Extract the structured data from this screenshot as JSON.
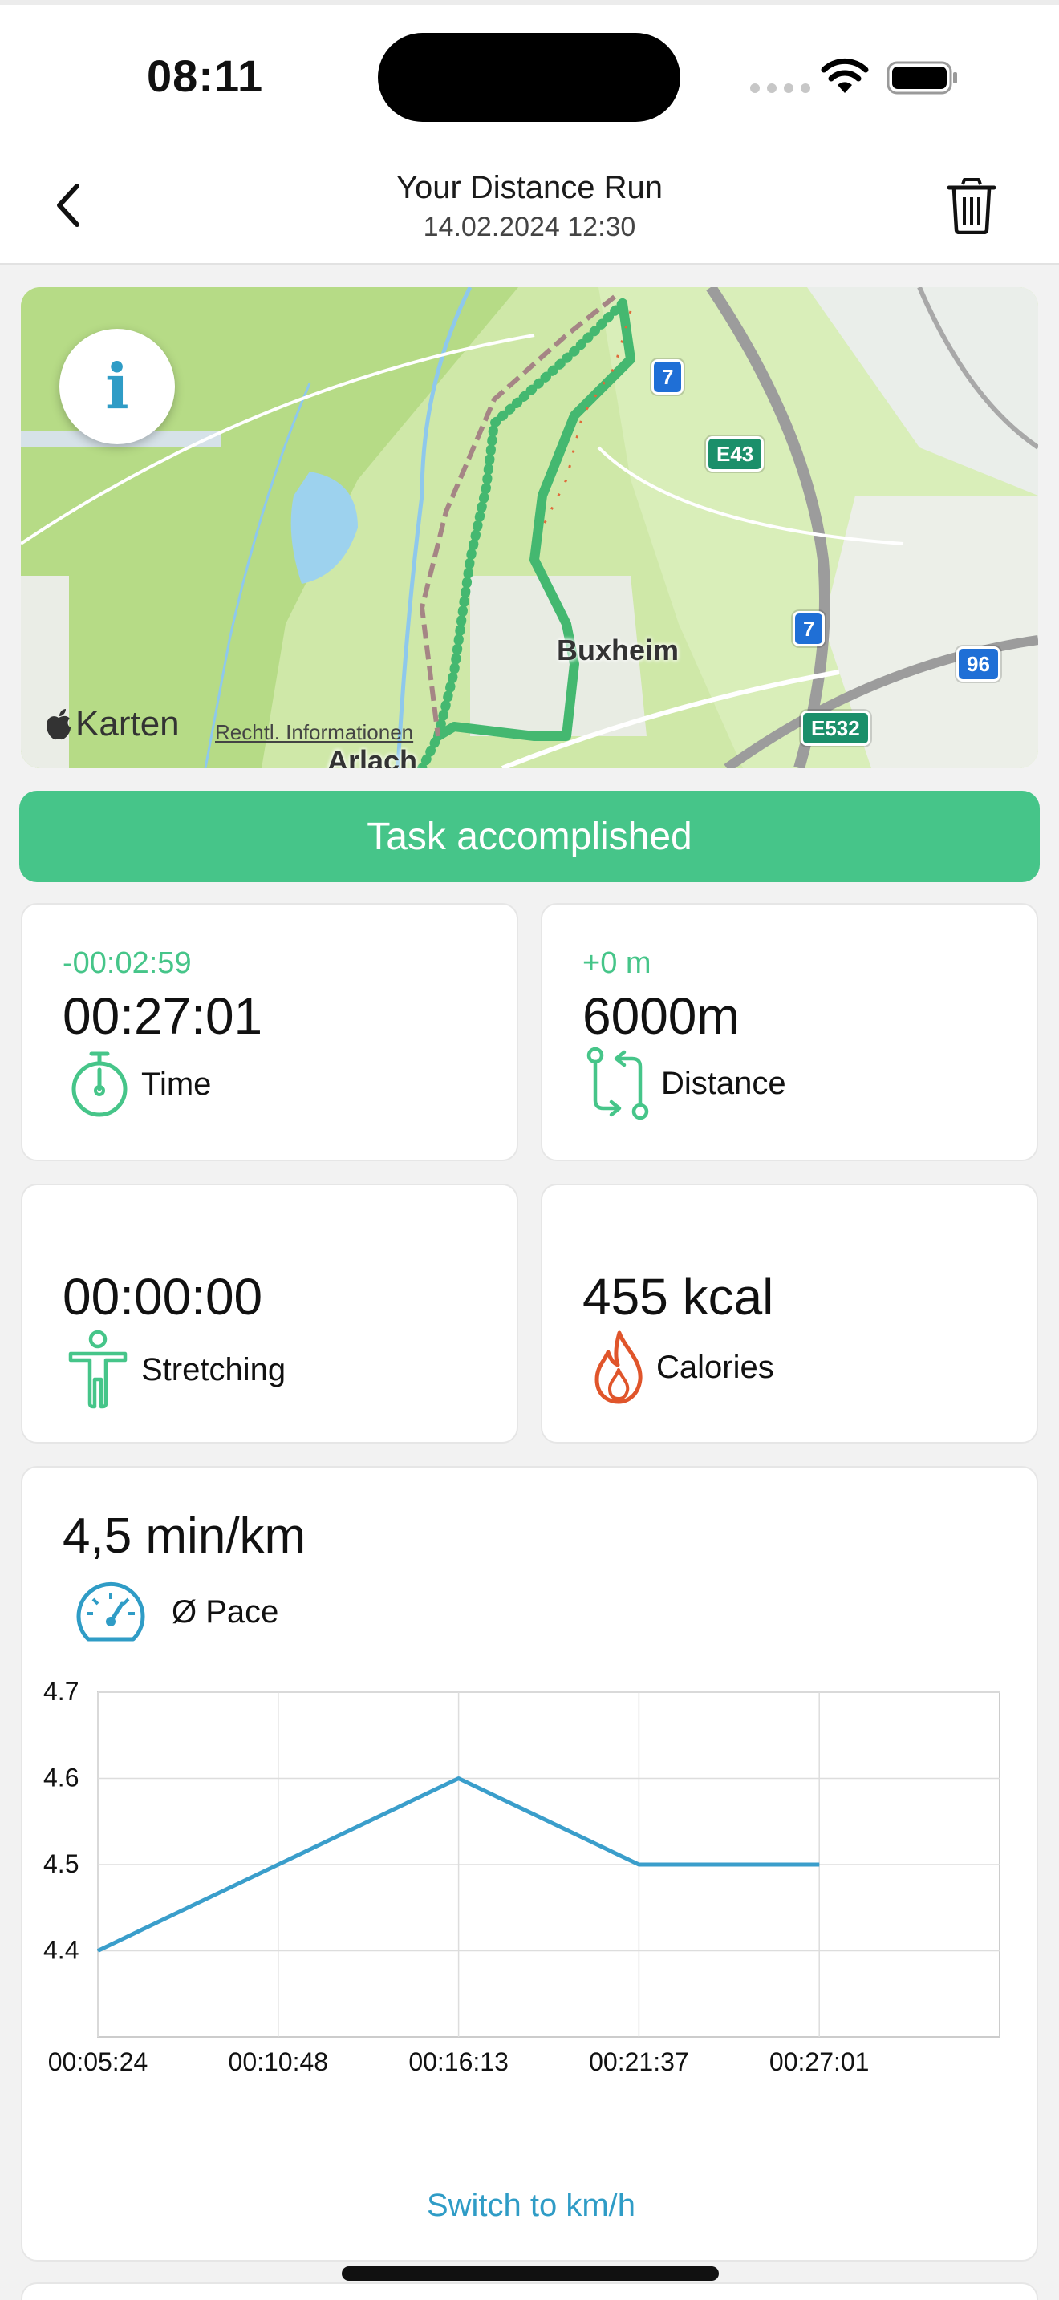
{
  "status_bar": {
    "time": "08:11"
  },
  "header": {
    "title": "Your Distance Run",
    "subtitle": "14.02.2024 12:30"
  },
  "map": {
    "labels": {
      "town1": "Buxheim",
      "town2": "Arlach"
    },
    "shields": [
      "7",
      "E43",
      "7",
      "96",
      "E532"
    ],
    "brand": "Karten",
    "legal": "Rechtl. Informationen"
  },
  "banner": {
    "text": "Task accomplished"
  },
  "stats": {
    "time": {
      "delta": "-00:02:59",
      "value": "00:27:01",
      "label": "Time"
    },
    "distance": {
      "delta": "+0 m",
      "value": "6000m",
      "label": "Distance"
    },
    "stretching": {
      "value": "00:00:00",
      "label": "Stretching"
    },
    "calories": {
      "value": "455 kcal",
      "label": "Calories"
    }
  },
  "pace": {
    "value": "4,5 min/km",
    "label": "Ø Pace",
    "switch_label": "Switch to km/h"
  },
  "colors": {
    "accent_green": "#46c589",
    "accent_blue": "#2f9cc6",
    "calorie_red": "#e0552b"
  },
  "chart_data": {
    "type": "line",
    "x": [
      "00:05:24",
      "00:10:48",
      "00:16:13",
      "00:21:37",
      "00:27:01"
    ],
    "series": [
      {
        "values": [
          4.4,
          4.5,
          4.6,
          4.5,
          4.5
        ]
      }
    ],
    "y_ticks": [
      "4.4",
      "4.5",
      "4.6",
      "4.7"
    ],
    "ylim": [
      4.3,
      4.7
    ],
    "grid": true,
    "color": "#3a9ecb"
  }
}
